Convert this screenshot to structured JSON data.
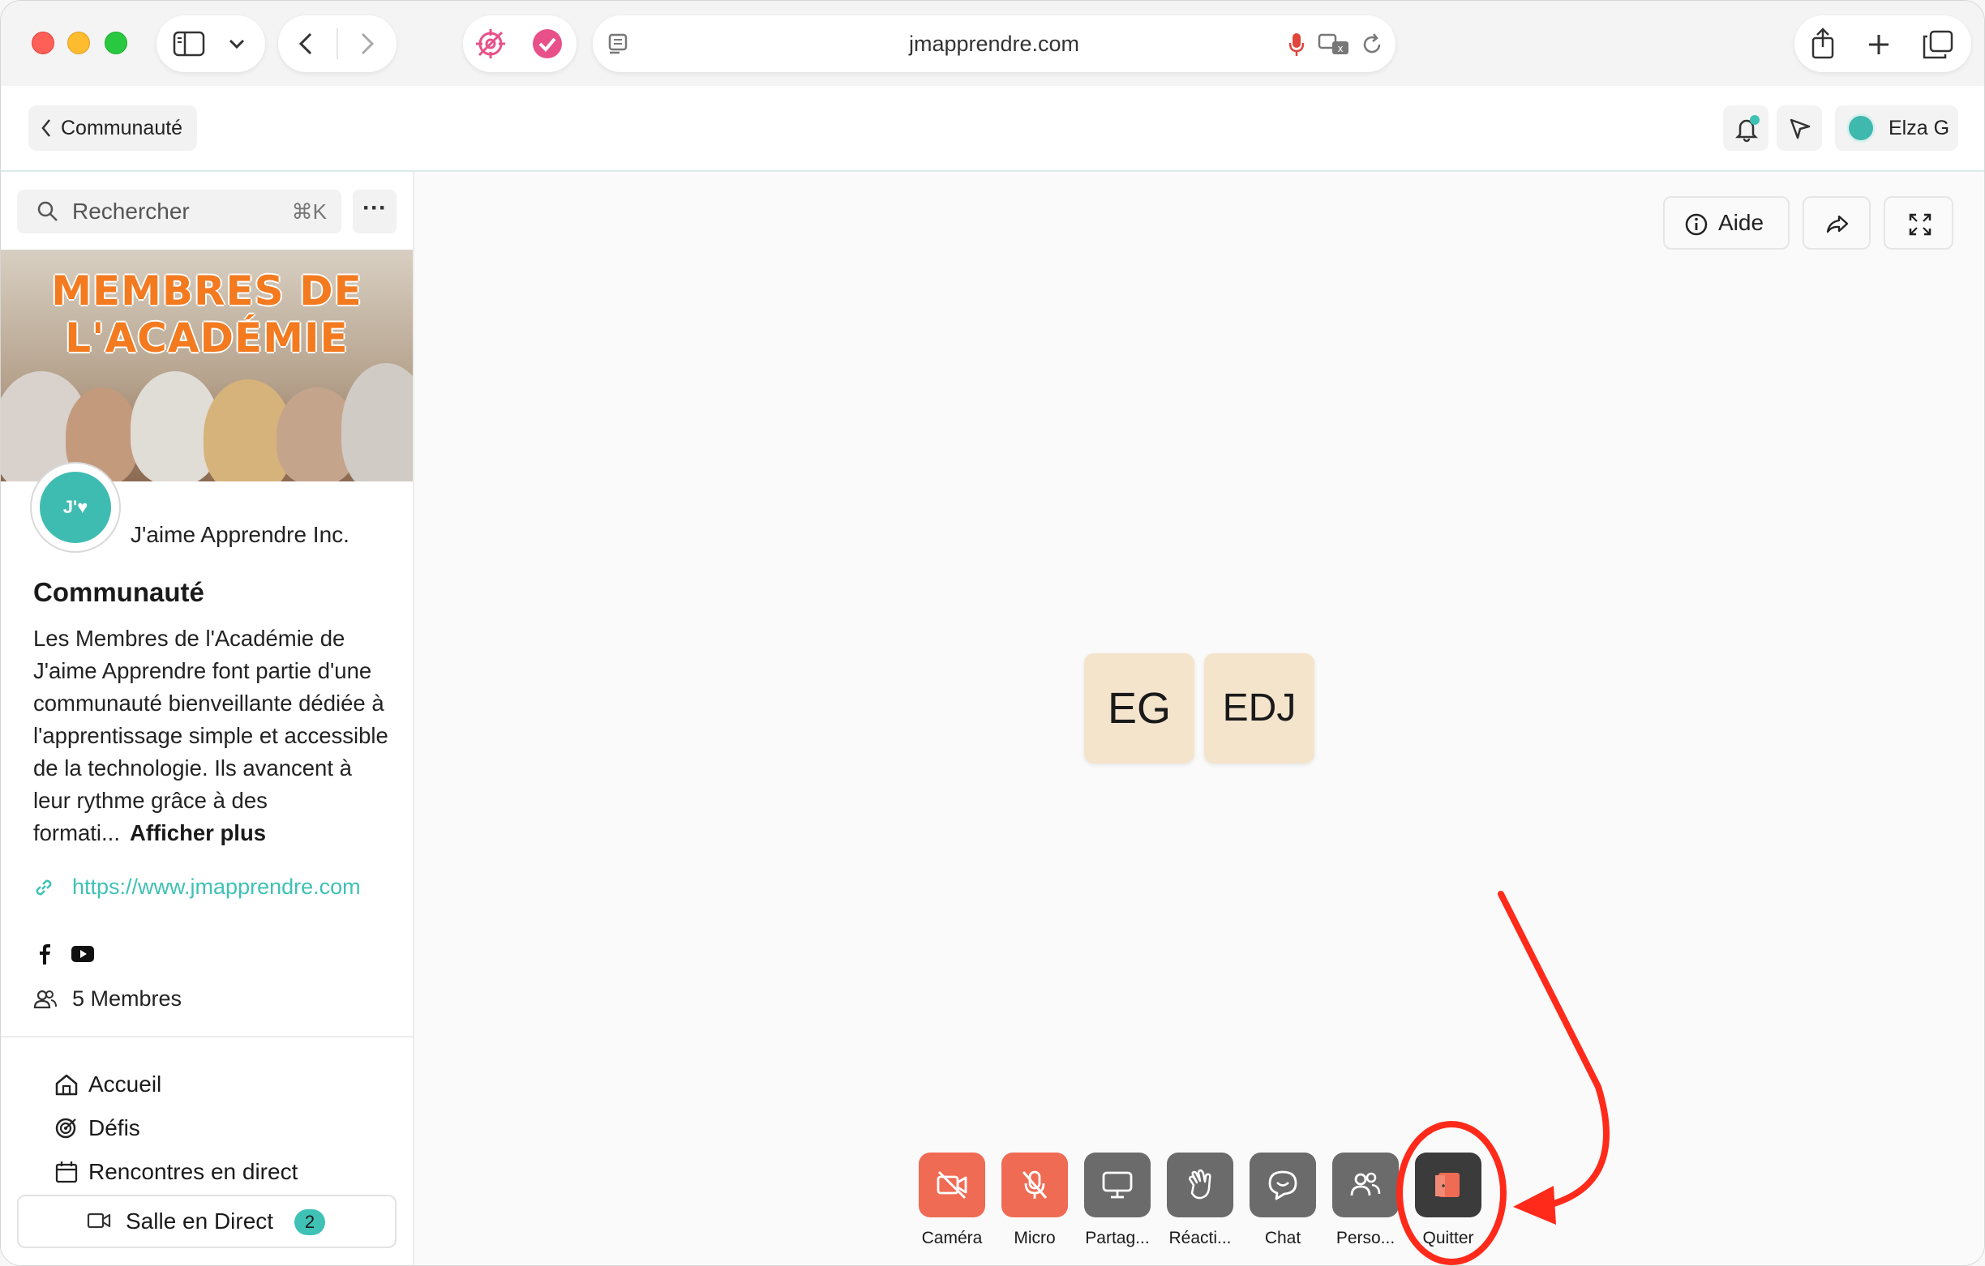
{
  "browser": {
    "url": "jmapprendre.com"
  },
  "header": {
    "back_label": "Communauté",
    "user_name": "Elza G"
  },
  "sidebar": {
    "search_placeholder": "Rechercher",
    "search_shortcut": "⌘K",
    "more_label": "···",
    "banner_title": "MEMBRES DE\nL'ACADÉMIE",
    "org_avatar_text": "J'♥",
    "org_name": "J'aime Apprendre Inc.",
    "community_title": "Communauté",
    "description": "Les Membres de l'Académie de J'aime Apprendre font partie d'une communauté bienveillante dédiée à l'apprentissage simple et accessible de la technologie. Ils avancent à leur rythme grâce à des formati...",
    "show_more": "Afficher plus",
    "link": "https://www.jmapprendre.com",
    "members": "5 Membres",
    "nav": [
      {
        "label": "Accueil",
        "icon": "home-icon"
      },
      {
        "label": "Défis",
        "icon": "target-icon"
      },
      {
        "label": "Rencontres en direct",
        "icon": "calendar-icon"
      }
    ],
    "live_room": {
      "label": "Salle en Direct",
      "count": "2"
    }
  },
  "main": {
    "help_label": "Aide",
    "participants": [
      {
        "initials": "EG"
      },
      {
        "initials": "EDJ"
      }
    ],
    "controls": [
      {
        "label": "Caméra",
        "icon": "camera-off-icon",
        "color": "#ef6b53"
      },
      {
        "label": "Micro",
        "icon": "mic-off-icon",
        "color": "#ef6b53"
      },
      {
        "label": "Partag...",
        "icon": "screen-share-icon",
        "color": "#6b6b6b"
      },
      {
        "label": "Réacti...",
        "icon": "hand-wave-icon",
        "color": "#6b6b6b"
      },
      {
        "label": "Chat",
        "icon": "chat-icon",
        "color": "#6b6b6b"
      },
      {
        "label": "Perso...",
        "icon": "people-icon",
        "color": "#6b6b6b"
      },
      {
        "label": "Quitter",
        "icon": "leave-door-icon",
        "color": "#3b3b3b"
      }
    ]
  },
  "colors": {
    "accent": "#3fc1b5",
    "control_red": "#ef6b53",
    "annotation_red": "#ff2a1a",
    "tile_bg": "#f5e4cc"
  }
}
